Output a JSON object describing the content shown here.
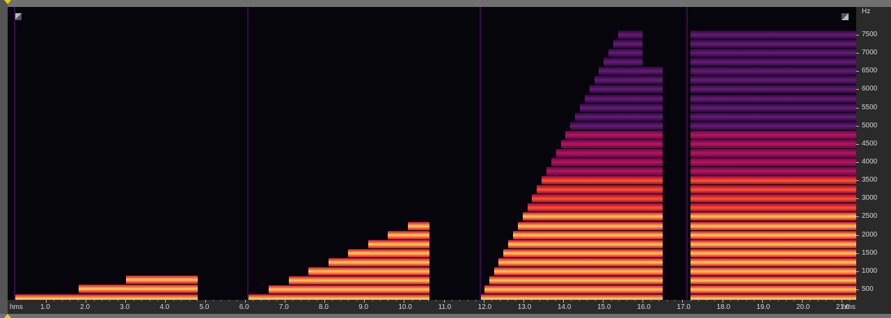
{
  "freq_axis": {
    "unit": "Hz",
    "ticks": [
      "7500",
      "7000",
      "6500",
      "6000",
      "5500",
      "5000",
      "4500",
      "4000",
      "3500",
      "3000",
      "2500",
      "2000",
      "1500",
      "1000",
      "500"
    ]
  },
  "time_axis": {
    "unit_left": "hms",
    "unit_right": "hms",
    "ticks": [
      "1.0",
      "2.0",
      "3.0",
      "4.0",
      "5.0",
      "6.0",
      "7.0",
      "8.0",
      "9.0",
      "10.0",
      "11.0",
      "12.0",
      "13.0",
      "14.0",
      "15.0",
      "16.0",
      "17.0",
      "18.0",
      "19.0",
      "20.0",
      "21.0"
    ]
  },
  "icons": {
    "top_left": "expand-corner-icon",
    "top_right": "collapse-corner-icon",
    "scroll_top": "position-marker-top-icon",
    "scroll_bottom": "position-marker-bottom-icon"
  },
  "colors": {
    "background": "#06050c",
    "hot": "#ffd86a",
    "mid": "#ff5a1e",
    "warm": "#c0125a",
    "cool": "#4a1870",
    "marker": "#f0d000"
  }
}
